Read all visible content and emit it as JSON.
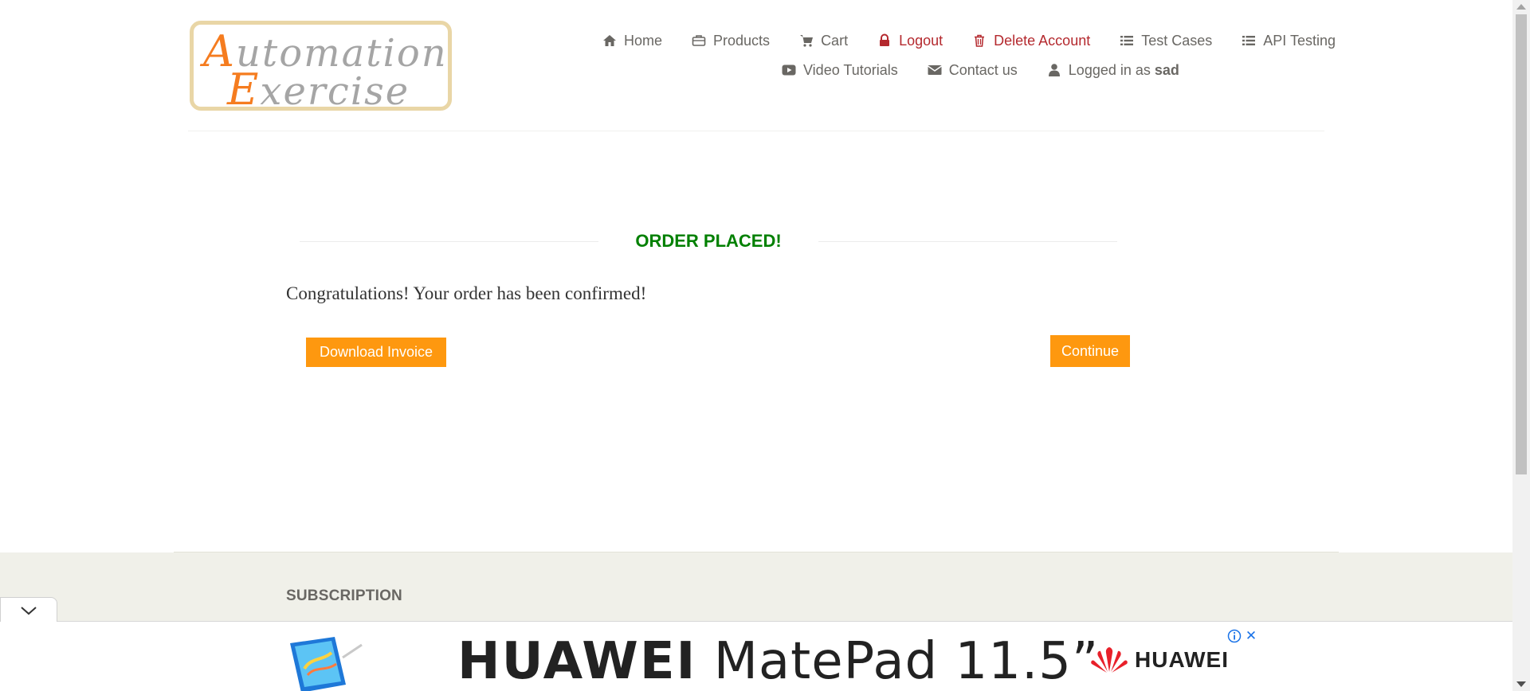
{
  "logo": {
    "line1_initial": "A",
    "line1_rest": "utomation",
    "line2_initial": "E",
    "line2_rest": "xercise"
  },
  "nav": {
    "row1": [
      {
        "label": "Home",
        "icon": "home-icon"
      },
      {
        "label": "Products",
        "icon": "briefcase-icon"
      },
      {
        "label": "Cart",
        "icon": "cart-icon"
      },
      {
        "label": "Logout",
        "icon": "lock-icon"
      },
      {
        "label": "Delete Account",
        "icon": "trash-icon"
      },
      {
        "label": "Test Cases",
        "icon": "list-icon"
      },
      {
        "label": "API Testing",
        "icon": "list-icon"
      }
    ],
    "row2": [
      {
        "label": "Video Tutorials",
        "icon": "youtube-icon"
      },
      {
        "label": "Contact us",
        "icon": "envelope-icon"
      },
      {
        "label": "Logged in as",
        "icon": "user-icon",
        "username": "sad"
      }
    ]
  },
  "main": {
    "title": "ORDER PLACED!",
    "message": "Congratulations! Your order has been confirmed!",
    "download_label": "Download Invoice",
    "continue_label": "Continue"
  },
  "footer": {
    "subscription_heading": "SUBSCRIPTION"
  },
  "ad": {
    "headline_brand": "HUAWEI",
    "headline_product": "MatePad 11.5”",
    "brand_name": "HUAWEI",
    "info_icon": "info-icon",
    "close_label": "✕"
  },
  "colors": {
    "accent": "#fe980f",
    "success": "#008000",
    "danger": "#b4292e",
    "text": "#696763"
  }
}
